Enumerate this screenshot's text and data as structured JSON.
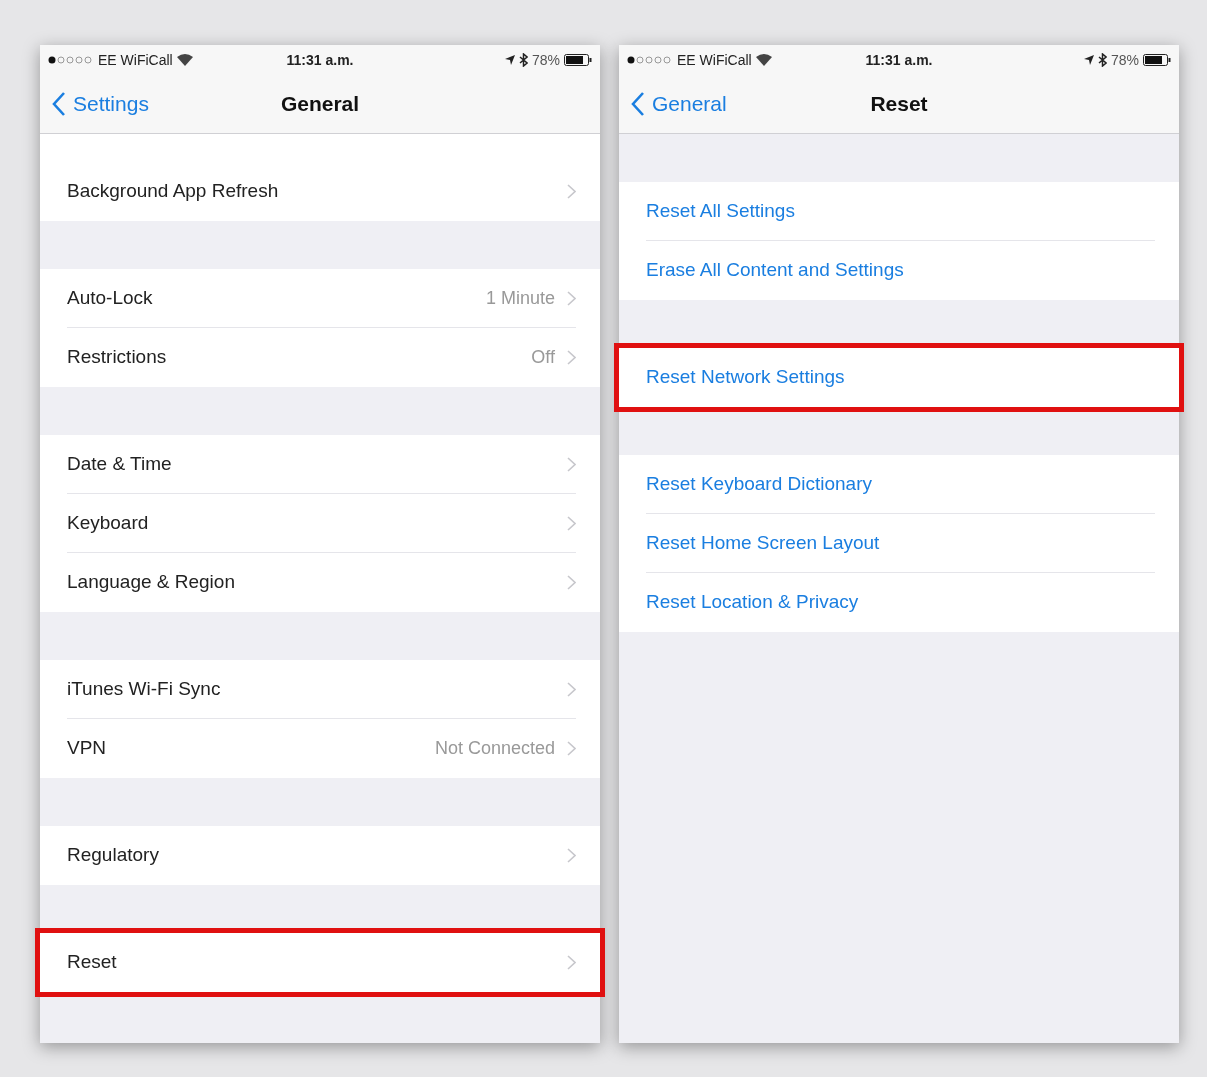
{
  "screens": [
    {
      "status_bar": {
        "carrier": "EE WiFiCall",
        "time": "11:31 a.m.",
        "battery": "78%"
      },
      "nav": {
        "back": "Settings",
        "title": "General"
      },
      "partial_top_row": true,
      "kind": "navigation",
      "sections": [
        [
          {
            "label": "Background App Refresh",
            "highlighted": false
          }
        ],
        [
          {
            "label": "Auto-Lock",
            "value": "1 Minute",
            "highlighted": false
          },
          {
            "label": "Restrictions",
            "value": "Off",
            "highlighted": false
          }
        ],
        [
          {
            "label": "Date & Time",
            "highlighted": false
          },
          {
            "label": "Keyboard",
            "highlighted": false
          },
          {
            "label": "Language & Region",
            "highlighted": false
          }
        ],
        [
          {
            "label": "iTunes Wi-Fi Sync",
            "highlighted": false
          },
          {
            "label": "VPN",
            "value": "Not Connected",
            "highlighted": false
          }
        ],
        [
          {
            "label": "Regulatory",
            "highlighted": false
          }
        ],
        [
          {
            "label": "Reset",
            "highlighted": true
          }
        ]
      ]
    },
    {
      "status_bar": {
        "carrier": "EE WiFiCall",
        "time": "11:31 a.m.",
        "battery": "78%"
      },
      "nav": {
        "back": "General",
        "title": "Reset"
      },
      "partial_top_row": false,
      "kind": "action",
      "sections": [
        [
          {
            "label": "Reset All Settings",
            "highlighted": false
          },
          {
            "label": "Erase All Content and Settings",
            "highlighted": false
          }
        ],
        [
          {
            "label": "Reset Network Settings",
            "highlighted": true
          }
        ],
        [
          {
            "label": "Reset Keyboard Dictionary",
            "highlighted": false
          },
          {
            "label": "Reset Home Screen Layout",
            "highlighted": false
          },
          {
            "label": "Reset Location & Privacy",
            "highlighted": false
          }
        ]
      ]
    }
  ]
}
